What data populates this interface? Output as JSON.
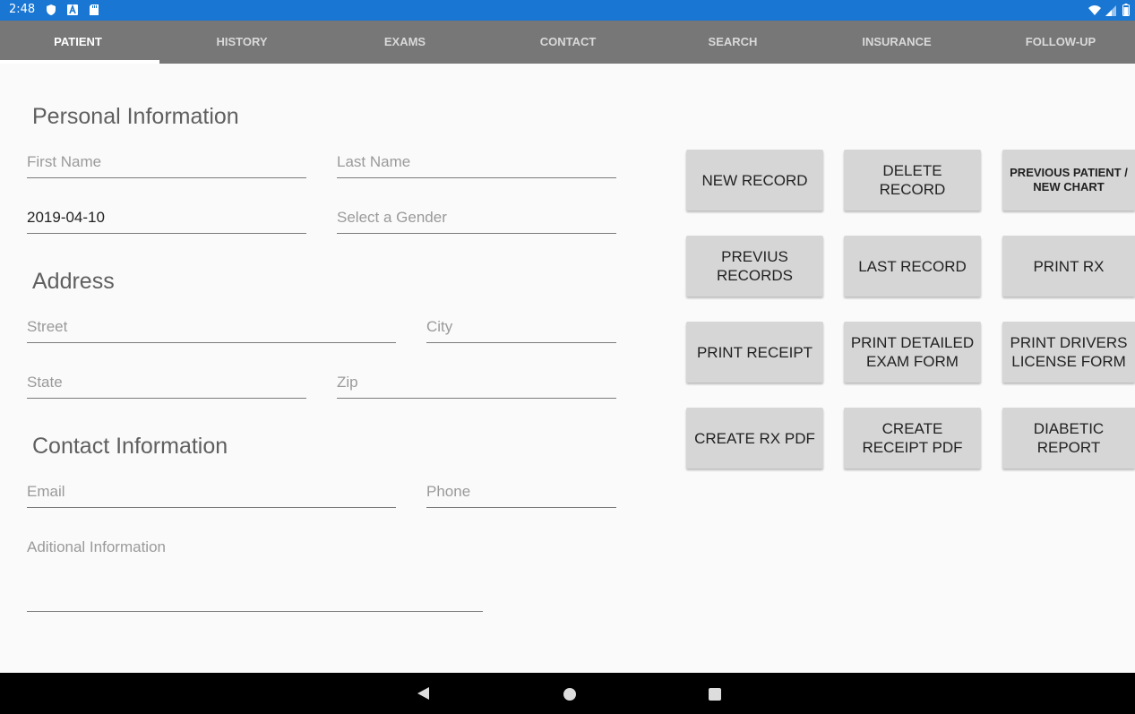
{
  "status": {
    "time": "2:48"
  },
  "tabs": [
    {
      "label": "PATIENT",
      "active": true
    },
    {
      "label": "HISTORY"
    },
    {
      "label": "EXAMS"
    },
    {
      "label": "CONTACT"
    },
    {
      "label": "SEARCH"
    },
    {
      "label": "INSURANCE"
    },
    {
      "label": "FOLLOW-UP"
    }
  ],
  "sections": {
    "personal": "Personal Information",
    "address": "Address",
    "contact": "Contact Information"
  },
  "fields": {
    "first_name": {
      "placeholder": "First Name",
      "value": ""
    },
    "last_name": {
      "placeholder": "Last Name",
      "value": ""
    },
    "date": {
      "placeholder": "",
      "value": "2019-04-10"
    },
    "gender": {
      "placeholder": "Select a Gender",
      "value": ""
    },
    "street": {
      "placeholder": "Street",
      "value": ""
    },
    "city": {
      "placeholder": "City",
      "value": ""
    },
    "state": {
      "placeholder": "State",
      "value": ""
    },
    "zip": {
      "placeholder": "Zip",
      "value": ""
    },
    "email": {
      "placeholder": "Email",
      "value": ""
    },
    "phone": {
      "placeholder": "Phone",
      "value": ""
    },
    "additional": {
      "placeholder": "Aditional Information",
      "value": ""
    }
  },
  "buttons": {
    "new_record": "NEW RECORD",
    "delete_record": "DELETE RECORD",
    "previous_patient": "PREVIOUS PATIENT / NEW CHART",
    "previous_records": "PREVIUS RECORDS",
    "last_record": "LAST RECORD",
    "print_rx": "PRINT RX",
    "print_receipt": "PRINT RECEIPT",
    "print_detailed_exam": "PRINT DETAILED EXAM FORM",
    "print_drivers_license": "PRINT DRIVERS LICENSE FORM",
    "create_rx_pdf": "CREATE RX PDF",
    "create_receipt_pdf": "CREATE RECEIPT PDF",
    "diabetic_report": "DIABETIC REPORT"
  },
  "colors": {
    "status_bar": "#1976d2",
    "tab_bar": "#777777",
    "button": "#d6d6d6",
    "background": "#fafafa"
  }
}
